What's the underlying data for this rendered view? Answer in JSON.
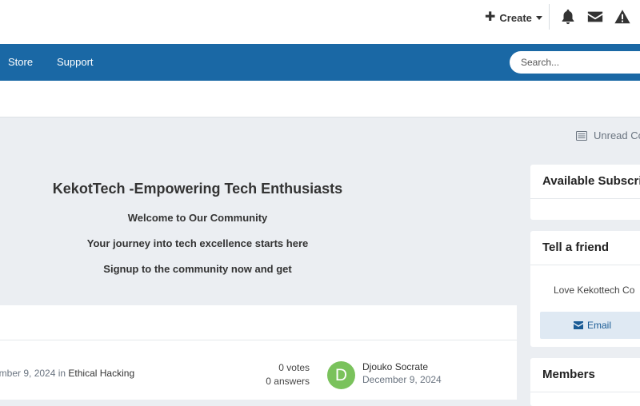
{
  "header": {
    "create_label": "Create",
    "icons": [
      "bell-icon",
      "envelope-icon",
      "warning-icon"
    ]
  },
  "nav": {
    "links": [
      "Store",
      "Support"
    ],
    "search_placeholder": "Search..."
  },
  "toolbar": {
    "unread_label": "Unread Co"
  },
  "hero": {
    "title": "KekotTech -Empowering Tech Enthusiasts",
    "line1": "Welcome to Our Community",
    "line2": "Your journey into tech excellence starts here",
    "line3": "Signup to the community now and get"
  },
  "feed": {
    "item": {
      "date_prefix": "ember 9, 2024",
      "in_word": " in ",
      "category": "Ethical Hacking",
      "votes": "0 votes",
      "answers": "0 answers",
      "avatar_letter": "D",
      "author": "Djouko Socrate",
      "date": "December 9, 2024"
    }
  },
  "sidebar": {
    "subscriptions_title": "Available Subscrip",
    "tell_friend_title": "Tell a friend",
    "tell_friend_text": "Love Kekottech Co",
    "email_label": "Email",
    "members_title": "Members"
  },
  "colors": {
    "nav_bg": "#1a68a5",
    "page_bg": "#ebeef2",
    "avatar_bg": "#7ac25c",
    "email_btn_bg": "#dfe9f3"
  }
}
